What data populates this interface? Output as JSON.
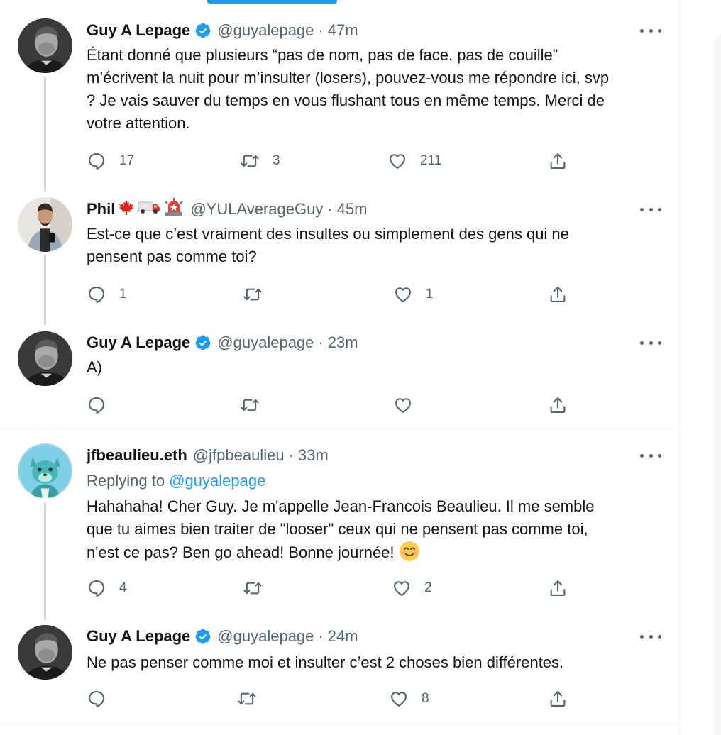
{
  "colors": {
    "accent": "#1d9bf0",
    "text": "#0f1419",
    "muted": "#536471",
    "thread_line": "#cfd9de",
    "border": "#eff3f4"
  },
  "tweets": [
    {
      "name": "Guy A Lepage",
      "verified": true,
      "handle": "@guyalepage",
      "time": "47m",
      "text_lines": [
        "Étant donné que plusieurs “pas de nom, pas de face, pas de couille”",
        "m’écrivent la nuit pour m’insulter (losers), pouvez-vous me répondre ici, svp",
        "? Je vais sauver du temps en vous flushant tous en même temps. Merci de",
        "votre attention."
      ],
      "reply_count": "17",
      "retweet_count": "3",
      "like_count": "211",
      "avatar_icon": "avatar-guy-photo"
    },
    {
      "name": "Phil",
      "verified": false,
      "name_emojis": [
        "maple-leaf-icon",
        "truck-icon",
        "siren-icon"
      ],
      "handle": "@YULAverageGuy",
      "time": "45m",
      "text_lines": [
        "Est-ce que c’est vraiment des insultes ou simplement des gens qui ne",
        "pensent pas comme toi?"
      ],
      "reply_count": "1",
      "retweet_count": "",
      "like_count": "1",
      "avatar_icon": "avatar-phil-photo"
    },
    {
      "name": "Guy A Lepage",
      "verified": true,
      "handle": "@guyalepage",
      "time": "23m",
      "text_lines": [
        "A)"
      ],
      "reply_count": "",
      "retweet_count": "",
      "like_count": "",
      "avatar_icon": "avatar-guy-photo"
    },
    {
      "name": "jfbeaulieu.eth",
      "verified": false,
      "handle": "@jfpbeaulieu",
      "time": "33m",
      "replying_to_label": "Replying to",
      "replying_to_handle": "@guyalepage",
      "text_lines": [
        "Hahahaha! Cher Guy. Je m'appelle Jean-Francois Beaulieu. Il me semble",
        "que tu aimes bien traiter de \"looser\" ceux qui ne pensent pas comme toi,",
        "n'est ce pas? Ben go ahead! Bonne journée!"
      ],
      "trailing_emoji": "smiling-face-icon",
      "reply_count": "4",
      "retweet_count": "",
      "like_count": "2",
      "avatar_icon": "avatar-wolf-nft"
    },
    {
      "name": "Guy A Lepage",
      "verified": true,
      "handle": "@guyalepage",
      "time": "24m",
      "text_lines": [
        "Ne pas penser comme moi et insulter c’est 2 choses bien différentes."
      ],
      "reply_count": "",
      "retweet_count": "",
      "like_count": "8",
      "avatar_icon": "avatar-guy-photo"
    }
  ],
  "separator": "·"
}
